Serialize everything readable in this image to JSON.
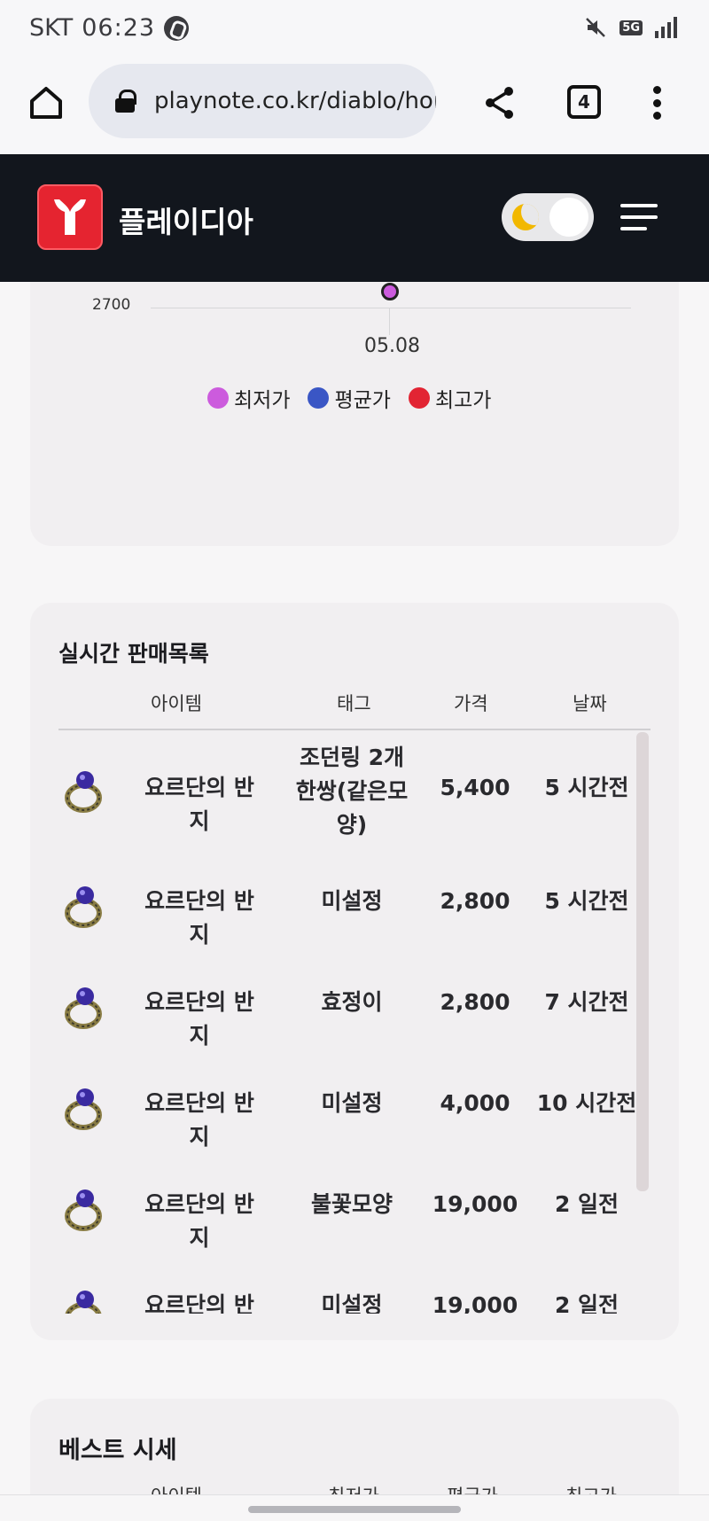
{
  "status_bar": {
    "carrier": "SKT",
    "time": "06:23",
    "network": "5G"
  },
  "browser": {
    "url": "playnote.co.kr/diablo/hor",
    "tab_count": "4"
  },
  "site": {
    "name": "플레이디아"
  },
  "chart": {
    "y_tick": "2700",
    "x_tick": "05.08",
    "legend": [
      {
        "label": "최저가",
        "color": "#cc5bdd"
      },
      {
        "label": "평균가",
        "color": "#3a56c5"
      },
      {
        "label": "최고가",
        "color": "#e22433"
      }
    ]
  },
  "chart_data": {
    "type": "line",
    "x": [
      "05.08"
    ],
    "series": [
      {
        "name": "최저가",
        "values": [
          2800
        ]
      }
    ],
    "yticks": [
      2700
    ],
    "legend_position": "bottom"
  },
  "sales": {
    "title": "실시간 판매목록",
    "headers": {
      "item": "아이템",
      "tag": "태그",
      "price": "가격",
      "date": "날짜"
    },
    "rows": [
      {
        "item": "요르단의 반지",
        "tag": "조던링 2개 한쌍(같은모양)",
        "price": "5,400",
        "date": "5 시간전"
      },
      {
        "item": "요르단의 반지",
        "tag": "미설정",
        "price": "2,800",
        "date": "5 시간전"
      },
      {
        "item": "요르단의 반지",
        "tag": "효정이",
        "price": "2,800",
        "date": "7 시간전"
      },
      {
        "item": "요르단의 반지",
        "tag": "미설정",
        "price": "4,000",
        "date": "10 시간전"
      },
      {
        "item": "요르단의 반지",
        "tag": "불꽃모양",
        "price": "19,000",
        "date": "2 일전"
      },
      {
        "item": "요르단의 반지",
        "tag": "미설정",
        "price": "19,000",
        "date": "2 일전"
      }
    ]
  },
  "best": {
    "title": "베스트 시세",
    "headers": {
      "item": "아이템",
      "low": "최저가",
      "avg": "평균가",
      "high": "최고가"
    }
  }
}
